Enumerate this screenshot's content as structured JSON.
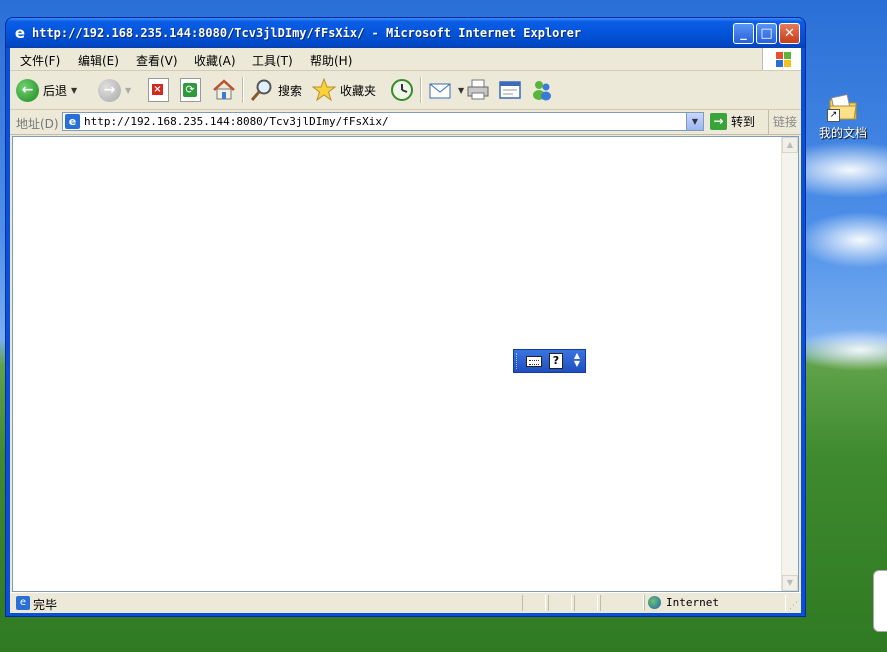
{
  "desktop": {
    "icon_label": "我的文档"
  },
  "window": {
    "title": "http://192.168.235.144:8080/Tcv3jlDImy/fFsXix/ - Microsoft Internet Explorer",
    "controls": {
      "minimize": "_",
      "maximize": "□",
      "close": "✕"
    }
  },
  "menu": {
    "items": [
      "文件(F)",
      "编辑(E)",
      "查看(V)",
      "收藏(A)",
      "工具(T)",
      "帮助(H)"
    ]
  },
  "toolbar": {
    "back_label": "后退",
    "search_label": "搜索",
    "favorites_label": "收藏夹"
  },
  "address": {
    "label": "地址(D)",
    "url": "http://192.168.235.144:8080/Tcv3jlDImy/fFsXix/",
    "go_label": "转到",
    "links_label": "链接"
  },
  "status": {
    "text": "完毕",
    "zone": "Internet"
  },
  "ime_toolbar": {
    "help_glyph": "?"
  }
}
